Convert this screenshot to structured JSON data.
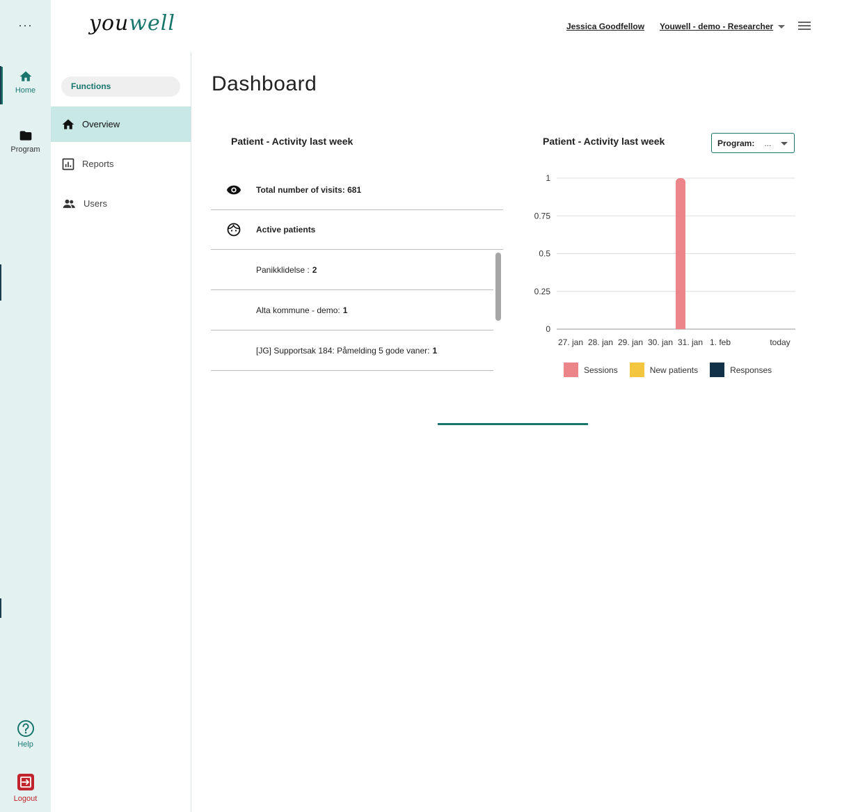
{
  "rail": {
    "more_label": "···",
    "home_label": "Home",
    "program_label": "Program",
    "help_label": "Help",
    "logout_label": "Logout"
  },
  "header": {
    "logo_part1": "you",
    "logo_part2": "well",
    "user_name": "Jessica Goodfellow",
    "org_role": "Youwell - demo - Researcher"
  },
  "subnav": {
    "functions_label": "Functions",
    "items": [
      {
        "label": "Overview",
        "icon": "home-icon",
        "active": true
      },
      {
        "label": "Reports",
        "icon": "chart-icon",
        "active": false
      },
      {
        "label": "Users",
        "icon": "users-icon",
        "active": false
      }
    ]
  },
  "main": {
    "title": "Dashboard",
    "left_card": {
      "title": "Patient - Activity last week",
      "visits_label": "Total number of visits: 681",
      "active_label": "Active patients",
      "programs": [
        {
          "name": "Panikklidelse :",
          "count": "2"
        },
        {
          "name": "Alta kommune - demo:",
          "count": "1"
        },
        {
          "name": "[JG] Supportsak 184: Påmelding 5 gode vaner:",
          "count": "1"
        }
      ]
    },
    "right_card": {
      "title": "Patient - Activity last week",
      "program_select_label": "Program:",
      "program_select_value": "..."
    }
  },
  "colors": {
    "accent": "#17756c",
    "sessions": "#ec8589",
    "new_patients": "#f4c53f",
    "responses": "#12324a"
  },
  "chart_data": {
    "type": "bar",
    "categories": [
      "27. jan",
      "28. jan",
      "29. jan",
      "30. jan",
      "31. jan",
      "1. feb",
      "today"
    ],
    "series": [
      {
        "name": "Sessions",
        "values": [
          0,
          0,
          1,
          0,
          0,
          0,
          0
        ]
      },
      {
        "name": "New patients",
        "values": [
          0,
          0,
          0,
          0,
          0,
          0,
          0
        ]
      },
      {
        "name": "Responses",
        "values": [
          0,
          0,
          0,
          0,
          0,
          0,
          0
        ]
      }
    ],
    "yticks": [
      "0",
      "0.25",
      "0.5",
      "0.75",
      "1"
    ],
    "ylim": [
      0,
      1
    ],
    "grid": true,
    "legend": "bottom"
  }
}
